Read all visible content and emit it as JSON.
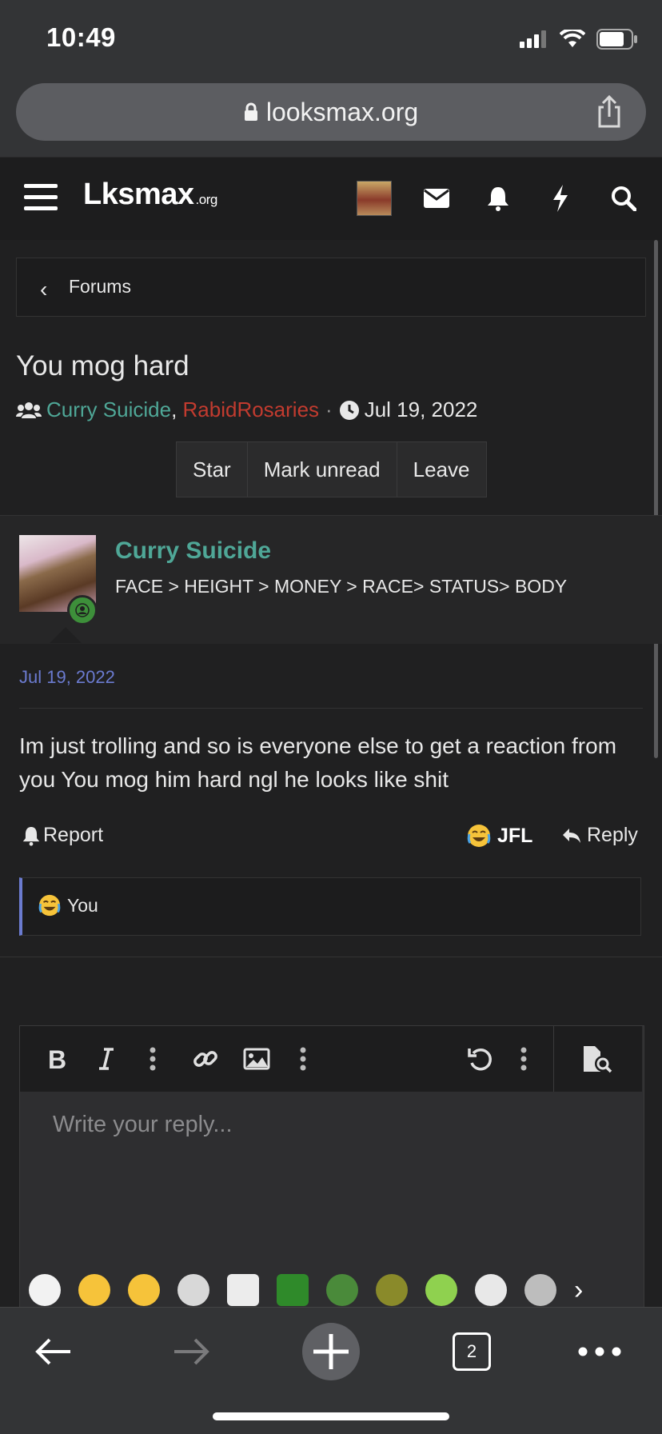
{
  "status": {
    "time": "10:49"
  },
  "browser": {
    "url": "looksmax.org",
    "tab_count": "2"
  },
  "site": {
    "logo_main": "Lksmax",
    "logo_suffix": ".org"
  },
  "breadcrumb": {
    "label": "Forums"
  },
  "thread": {
    "title": "You mog hard",
    "participants": [
      "Curry Suicide",
      "RabidRosaries"
    ],
    "date": "Jul 19, 2022",
    "actions": [
      "Star",
      "Mark unread",
      "Leave"
    ]
  },
  "post": {
    "author": "Curry Suicide",
    "signature": "FACE > HEIGHT > MONEY > RACE> STATUS> BODY",
    "date": "Jul 19, 2022",
    "body": "Im just trolling and so is everyone else to get a reaction from you You mog him hard ngl he looks like shit",
    "report_label": "Report",
    "reaction_label": "JFL",
    "reply_label": "Reply",
    "reaction_summary": "You"
  },
  "editor": {
    "placeholder": "Write your reply..."
  },
  "colors": {
    "accent_user": "#4fa797",
    "user_red": "#c23b2f",
    "link_blue": "#6b7bd0"
  }
}
